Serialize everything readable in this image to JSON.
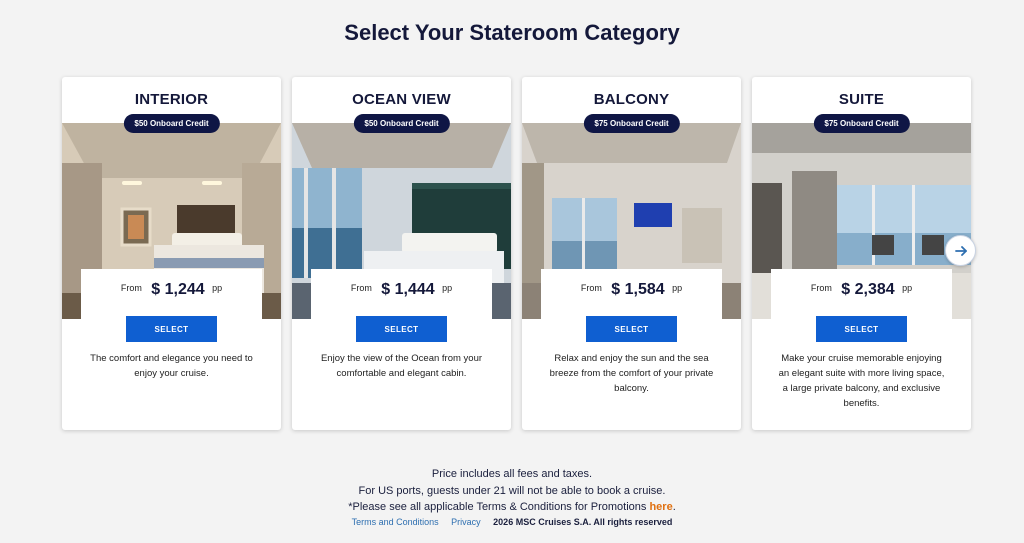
{
  "page": {
    "title": "Select Your Stateroom Category"
  },
  "cards": [
    {
      "name": "INTERIOR",
      "credit": "$50 Onboard Credit",
      "from_label": "From",
      "price": "$ 1,244",
      "pp_label": "pp",
      "button_label": "SELECT",
      "description": "The comfort and elegance you need to enjoy your cruise.",
      "image_icon": "interior-cabin-photo"
    },
    {
      "name": "OCEAN VIEW",
      "credit": "$50 Onboard Credit",
      "from_label": "From",
      "price": "$ 1,444",
      "pp_label": "pp",
      "button_label": "SELECT",
      "description": "Enjoy the view of the Ocean from your comfortable and elegant cabin.",
      "image_icon": "ocean-view-cabin-photo"
    },
    {
      "name": "BALCONY",
      "credit": "$75 Onboard Credit",
      "from_label": "From",
      "price": "$ 1,584",
      "pp_label": "pp",
      "button_label": "SELECT",
      "description": "Relax and enjoy the sun and the sea breeze from the comfort of your private balcony.",
      "image_icon": "balcony-cabin-photo"
    },
    {
      "name": "SUITE",
      "credit": "$75 Onboard Credit",
      "from_label": "From",
      "price": "$ 2,384",
      "pp_label": "pp",
      "button_label": "SELECT",
      "description": "Make your cruise memorable enjoying an elegant suite with more living space, a large private balcony, and exclusive benefits.",
      "image_icon": "suite-cabin-photo"
    }
  ],
  "carousel": {
    "next_icon": "arrow-right-icon"
  },
  "footer": {
    "line1": "Price includes all fees and taxes.",
    "line2": "For US ports, guests under 21 will not be able to book a cruise.",
    "line3_prefix": "*Please see all applicable Terms & Conditions for Promotions",
    "line3_link": "here",
    "line3_suffix": ".",
    "terms_link": "Terms and Conditions",
    "privacy_link": "Privacy",
    "copyright": "2026 MSC Cruises S.A. All rights reserved"
  },
  "colors": {
    "primary_button": "#0f5fd1",
    "badge_bg": "#0f1645",
    "heading": "#14183a",
    "link_orange": "#e07010",
    "link_blue": "#2e6fb0",
    "page_bg": "#f3f3f3"
  }
}
